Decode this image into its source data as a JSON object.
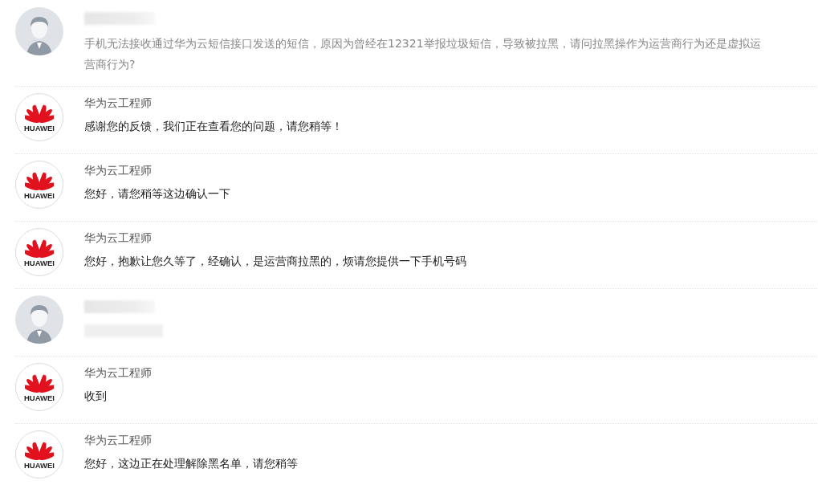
{
  "messages": [
    {
      "kind": "user",
      "name_redacted": true,
      "text": "手机无法接收通过华为云短信接口发送的短信，原因为曾经在12321举报垃圾短信，导致被拉黑，请问拉黑操作为运营商行为还是虚拟运营商行为?",
      "text_redacted": false
    },
    {
      "kind": "engineer",
      "logo_text": "HUAWEI",
      "name": "华为云工程师",
      "text": "感谢您的反馈，我们正在查看您的问题，请您稍等！"
    },
    {
      "kind": "engineer",
      "logo_text": "HUAWEI",
      "name": "华为云工程师",
      "text": "您好，请您稍等这边确认一下"
    },
    {
      "kind": "engineer",
      "logo_text": "HUAWEI",
      "name": "华为云工程师",
      "text": "您好，抱歉让您久等了，经确认，是运营商拉黑的，烦请您提供一下手机号码"
    },
    {
      "kind": "user",
      "name_redacted": true,
      "text_redacted": true
    },
    {
      "kind": "engineer",
      "logo_text": "HUAWEI",
      "name": "华为云工程师",
      "text": "收到"
    },
    {
      "kind": "engineer",
      "logo_text": "HUAWEI",
      "name": "华为云工程师",
      "text": "您好，这边正在处理解除黑名单，请您稍等"
    }
  ]
}
